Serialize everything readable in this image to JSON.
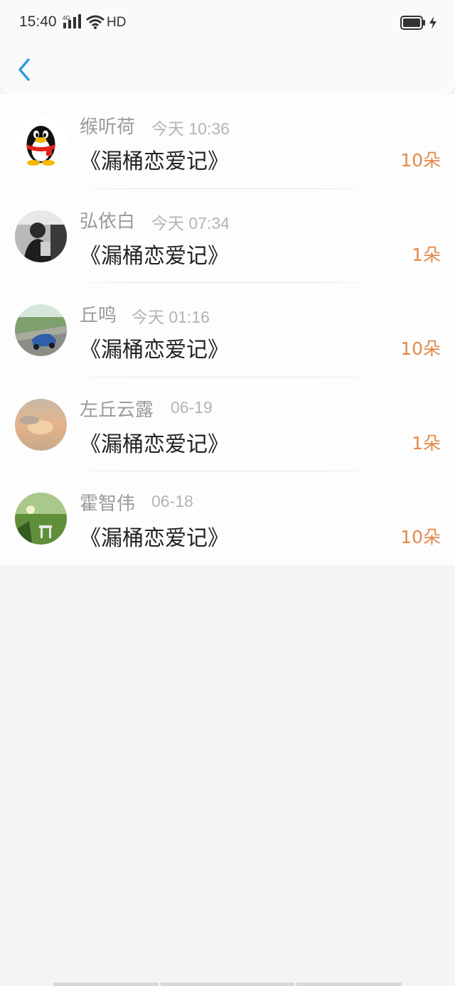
{
  "status_bar": {
    "time": "15:40",
    "network": "4G",
    "hd": "HD",
    "icons": [
      "signal-icon",
      "wifi-icon",
      "battery-icon",
      "charging-icon"
    ]
  },
  "nav": {
    "back_icon": "chevron-left-icon",
    "accent": "#2d9ae0"
  },
  "colors": {
    "amount": "#e28a4b",
    "name": "#9a9a9a",
    "time": "#b4b4b4",
    "title": "#222222"
  },
  "items": [
    {
      "name": "缑听荷",
      "time": "今天 10:36",
      "title": "《漏桶恋爱记》",
      "amount": "10朵",
      "avatar": "qq-penguin-avatar"
    },
    {
      "name": "弘依白",
      "time": "今天 07:34",
      "title": "《漏桶恋爱记》",
      "amount": "1朵",
      "avatar": "person-photo-avatar"
    },
    {
      "name": "丘鸣",
      "time": "今天 01:16",
      "title": "《漏桶恋爱记》",
      "amount": "10朵",
      "avatar": "car-photo-avatar"
    },
    {
      "name": "左丘云露",
      "time": "06-19",
      "title": "《漏桶恋爱记》",
      "amount": "1朵",
      "avatar": "sunset-sky-avatar"
    },
    {
      "name": "霍智伟",
      "time": "06-18",
      "title": "《漏桶恋爱记》",
      "amount": "10朵",
      "avatar": "garden-photo-avatar"
    }
  ]
}
